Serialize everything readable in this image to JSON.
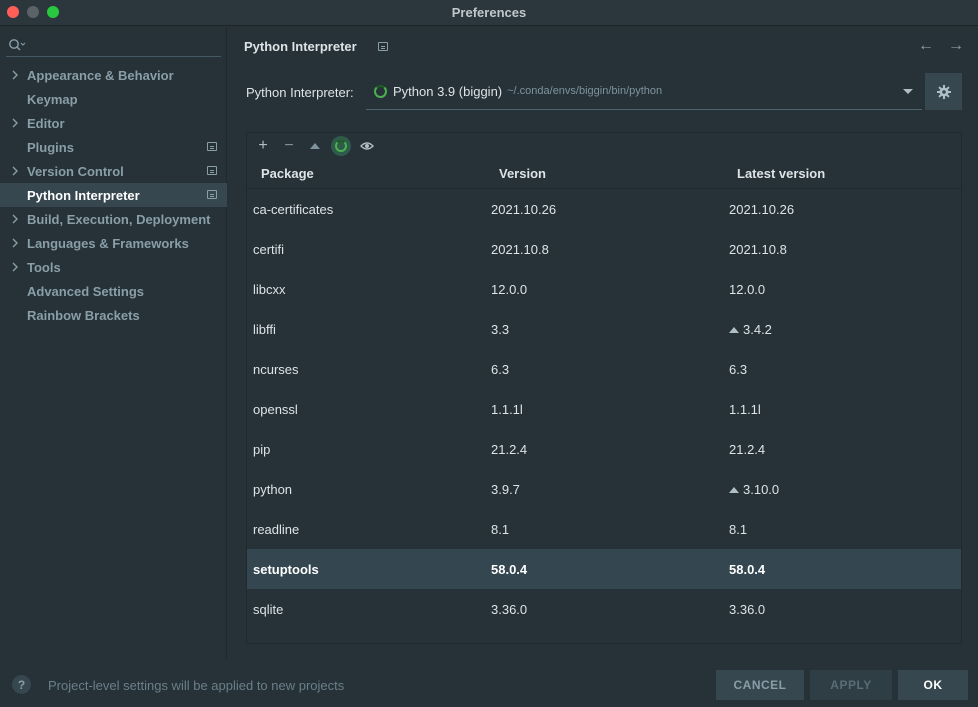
{
  "window": {
    "title": "Preferences"
  },
  "sidebar": {
    "search_placeholder": "",
    "items": [
      {
        "label": "Appearance & Behavior",
        "expandable": true,
        "page_icon": false,
        "active": false
      },
      {
        "label": "Keymap",
        "expandable": false,
        "page_icon": false,
        "active": false
      },
      {
        "label": "Editor",
        "expandable": true,
        "page_icon": false,
        "active": false
      },
      {
        "label": "Plugins",
        "expandable": false,
        "page_icon": true,
        "active": false
      },
      {
        "label": "Version Control",
        "expandable": true,
        "page_icon": true,
        "active": false
      },
      {
        "label": "Python Interpreter",
        "expandable": false,
        "page_icon": true,
        "active": true
      },
      {
        "label": "Build, Execution, Deployment",
        "expandable": true,
        "page_icon": false,
        "active": false
      },
      {
        "label": "Languages & Frameworks",
        "expandable": true,
        "page_icon": false,
        "active": false
      },
      {
        "label": "Tools",
        "expandable": true,
        "page_icon": false,
        "active": false
      },
      {
        "label": "Advanced Settings",
        "expandable": false,
        "page_icon": false,
        "active": false
      },
      {
        "label": "Rainbow Brackets",
        "expandable": false,
        "page_icon": false,
        "active": false
      }
    ]
  },
  "header": {
    "breadcrumb": "Python Interpreter",
    "back_icon": "arrow-left-icon",
    "forward_icon": "arrow-right-icon"
  },
  "interpreter": {
    "label": "Python Interpreter:",
    "name": "Python 3.9 (biggin)",
    "path": "~/.conda/envs/biggin/bin/python"
  },
  "table": {
    "headers": [
      "Package",
      "Version",
      "Latest version"
    ],
    "rows": [
      {
        "package": "ca-certificates",
        "version": "2021.10.26",
        "latest": "2021.10.26",
        "upgrade": false
      },
      {
        "package": "certifi",
        "version": "2021.10.8",
        "latest": "2021.10.8",
        "upgrade": false
      },
      {
        "package": "libcxx",
        "version": "12.0.0",
        "latest": "12.0.0",
        "upgrade": false
      },
      {
        "package": "libffi",
        "version": "3.3",
        "latest": "3.4.2",
        "upgrade": true
      },
      {
        "package": "ncurses",
        "version": "6.3",
        "latest": "6.3",
        "upgrade": false
      },
      {
        "package": "openssl",
        "version": "1.1.1l",
        "latest": "1.1.1l",
        "upgrade": false
      },
      {
        "package": "pip",
        "version": "21.2.4",
        "latest": "21.2.4",
        "upgrade": false
      },
      {
        "package": "python",
        "version": "3.9.7",
        "latest": "3.10.0",
        "upgrade": true
      },
      {
        "package": "readline",
        "version": "8.1",
        "latest": "8.1",
        "upgrade": false
      },
      {
        "package": "setuptools",
        "version": "58.0.4",
        "latest": "58.0.4",
        "upgrade": false,
        "selected": true
      },
      {
        "package": "sqlite",
        "version": "3.36.0",
        "latest": "3.36.0",
        "upgrade": false
      }
    ]
  },
  "footer": {
    "help_label": "?",
    "hint": "Project-level settings will be applied to new projects",
    "cancel_label": "CANCEL",
    "apply_label": "APPLY",
    "ok_label": "OK"
  }
}
